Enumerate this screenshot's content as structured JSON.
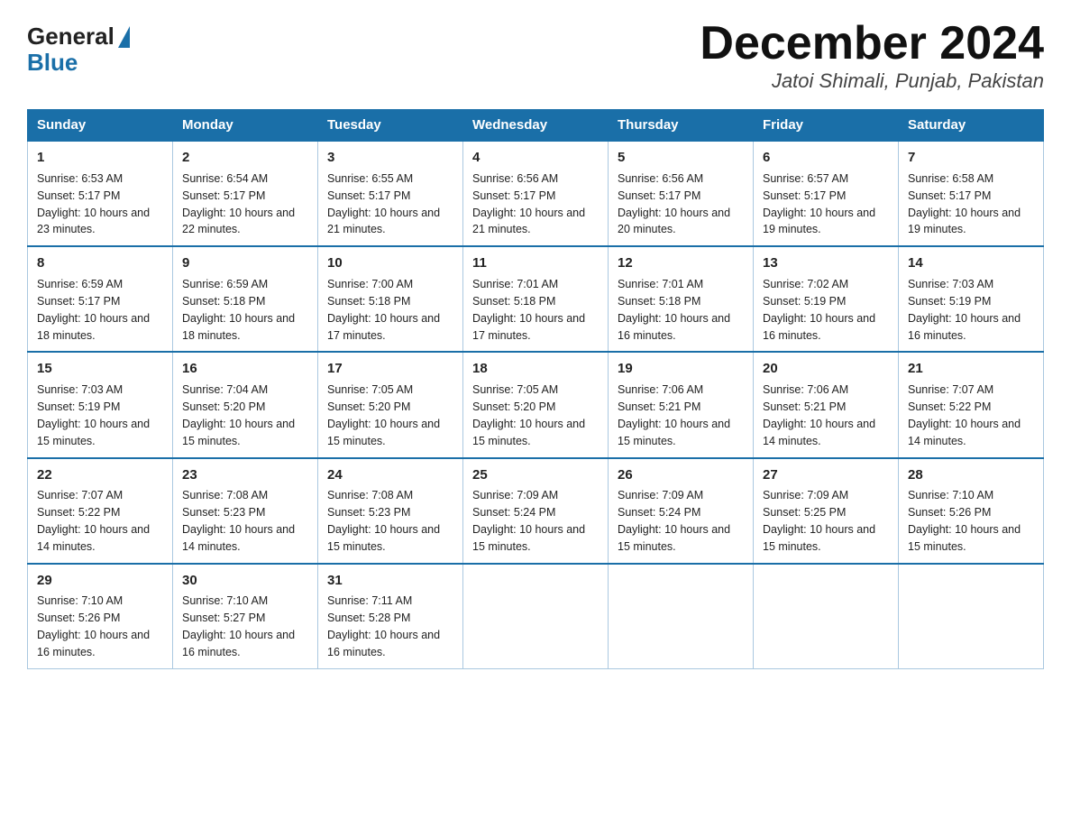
{
  "header": {
    "logo_general": "General",
    "logo_blue": "Blue",
    "month_year": "December 2024",
    "location": "Jatoi Shimali, Punjab, Pakistan"
  },
  "weekdays": [
    "Sunday",
    "Monday",
    "Tuesday",
    "Wednesday",
    "Thursday",
    "Friday",
    "Saturday"
  ],
  "weeks": [
    [
      {
        "num": "1",
        "sunrise": "Sunrise: 6:53 AM",
        "sunset": "Sunset: 5:17 PM",
        "daylight": "Daylight: 10 hours and 23 minutes."
      },
      {
        "num": "2",
        "sunrise": "Sunrise: 6:54 AM",
        "sunset": "Sunset: 5:17 PM",
        "daylight": "Daylight: 10 hours and 22 minutes."
      },
      {
        "num": "3",
        "sunrise": "Sunrise: 6:55 AM",
        "sunset": "Sunset: 5:17 PM",
        "daylight": "Daylight: 10 hours and 21 minutes."
      },
      {
        "num": "4",
        "sunrise": "Sunrise: 6:56 AM",
        "sunset": "Sunset: 5:17 PM",
        "daylight": "Daylight: 10 hours and 21 minutes."
      },
      {
        "num": "5",
        "sunrise": "Sunrise: 6:56 AM",
        "sunset": "Sunset: 5:17 PM",
        "daylight": "Daylight: 10 hours and 20 minutes."
      },
      {
        "num": "6",
        "sunrise": "Sunrise: 6:57 AM",
        "sunset": "Sunset: 5:17 PM",
        "daylight": "Daylight: 10 hours and 19 minutes."
      },
      {
        "num": "7",
        "sunrise": "Sunrise: 6:58 AM",
        "sunset": "Sunset: 5:17 PM",
        "daylight": "Daylight: 10 hours and 19 minutes."
      }
    ],
    [
      {
        "num": "8",
        "sunrise": "Sunrise: 6:59 AM",
        "sunset": "Sunset: 5:17 PM",
        "daylight": "Daylight: 10 hours and 18 minutes."
      },
      {
        "num": "9",
        "sunrise": "Sunrise: 6:59 AM",
        "sunset": "Sunset: 5:18 PM",
        "daylight": "Daylight: 10 hours and 18 minutes."
      },
      {
        "num": "10",
        "sunrise": "Sunrise: 7:00 AM",
        "sunset": "Sunset: 5:18 PM",
        "daylight": "Daylight: 10 hours and 17 minutes."
      },
      {
        "num": "11",
        "sunrise": "Sunrise: 7:01 AM",
        "sunset": "Sunset: 5:18 PM",
        "daylight": "Daylight: 10 hours and 17 minutes."
      },
      {
        "num": "12",
        "sunrise": "Sunrise: 7:01 AM",
        "sunset": "Sunset: 5:18 PM",
        "daylight": "Daylight: 10 hours and 16 minutes."
      },
      {
        "num": "13",
        "sunrise": "Sunrise: 7:02 AM",
        "sunset": "Sunset: 5:19 PM",
        "daylight": "Daylight: 10 hours and 16 minutes."
      },
      {
        "num": "14",
        "sunrise": "Sunrise: 7:03 AM",
        "sunset": "Sunset: 5:19 PM",
        "daylight": "Daylight: 10 hours and 16 minutes."
      }
    ],
    [
      {
        "num": "15",
        "sunrise": "Sunrise: 7:03 AM",
        "sunset": "Sunset: 5:19 PM",
        "daylight": "Daylight: 10 hours and 15 minutes."
      },
      {
        "num": "16",
        "sunrise": "Sunrise: 7:04 AM",
        "sunset": "Sunset: 5:20 PM",
        "daylight": "Daylight: 10 hours and 15 minutes."
      },
      {
        "num": "17",
        "sunrise": "Sunrise: 7:05 AM",
        "sunset": "Sunset: 5:20 PM",
        "daylight": "Daylight: 10 hours and 15 minutes."
      },
      {
        "num": "18",
        "sunrise": "Sunrise: 7:05 AM",
        "sunset": "Sunset: 5:20 PM",
        "daylight": "Daylight: 10 hours and 15 minutes."
      },
      {
        "num": "19",
        "sunrise": "Sunrise: 7:06 AM",
        "sunset": "Sunset: 5:21 PM",
        "daylight": "Daylight: 10 hours and 15 minutes."
      },
      {
        "num": "20",
        "sunrise": "Sunrise: 7:06 AM",
        "sunset": "Sunset: 5:21 PM",
        "daylight": "Daylight: 10 hours and 14 minutes."
      },
      {
        "num": "21",
        "sunrise": "Sunrise: 7:07 AM",
        "sunset": "Sunset: 5:22 PM",
        "daylight": "Daylight: 10 hours and 14 minutes."
      }
    ],
    [
      {
        "num": "22",
        "sunrise": "Sunrise: 7:07 AM",
        "sunset": "Sunset: 5:22 PM",
        "daylight": "Daylight: 10 hours and 14 minutes."
      },
      {
        "num": "23",
        "sunrise": "Sunrise: 7:08 AM",
        "sunset": "Sunset: 5:23 PM",
        "daylight": "Daylight: 10 hours and 14 minutes."
      },
      {
        "num": "24",
        "sunrise": "Sunrise: 7:08 AM",
        "sunset": "Sunset: 5:23 PM",
        "daylight": "Daylight: 10 hours and 15 minutes."
      },
      {
        "num": "25",
        "sunrise": "Sunrise: 7:09 AM",
        "sunset": "Sunset: 5:24 PM",
        "daylight": "Daylight: 10 hours and 15 minutes."
      },
      {
        "num": "26",
        "sunrise": "Sunrise: 7:09 AM",
        "sunset": "Sunset: 5:24 PM",
        "daylight": "Daylight: 10 hours and 15 minutes."
      },
      {
        "num": "27",
        "sunrise": "Sunrise: 7:09 AM",
        "sunset": "Sunset: 5:25 PM",
        "daylight": "Daylight: 10 hours and 15 minutes."
      },
      {
        "num": "28",
        "sunrise": "Sunrise: 7:10 AM",
        "sunset": "Sunset: 5:26 PM",
        "daylight": "Daylight: 10 hours and 15 minutes."
      }
    ],
    [
      {
        "num": "29",
        "sunrise": "Sunrise: 7:10 AM",
        "sunset": "Sunset: 5:26 PM",
        "daylight": "Daylight: 10 hours and 16 minutes."
      },
      {
        "num": "30",
        "sunrise": "Sunrise: 7:10 AM",
        "sunset": "Sunset: 5:27 PM",
        "daylight": "Daylight: 10 hours and 16 minutes."
      },
      {
        "num": "31",
        "sunrise": "Sunrise: 7:11 AM",
        "sunset": "Sunset: 5:28 PM",
        "daylight": "Daylight: 10 hours and 16 minutes."
      },
      null,
      null,
      null,
      null
    ]
  ]
}
